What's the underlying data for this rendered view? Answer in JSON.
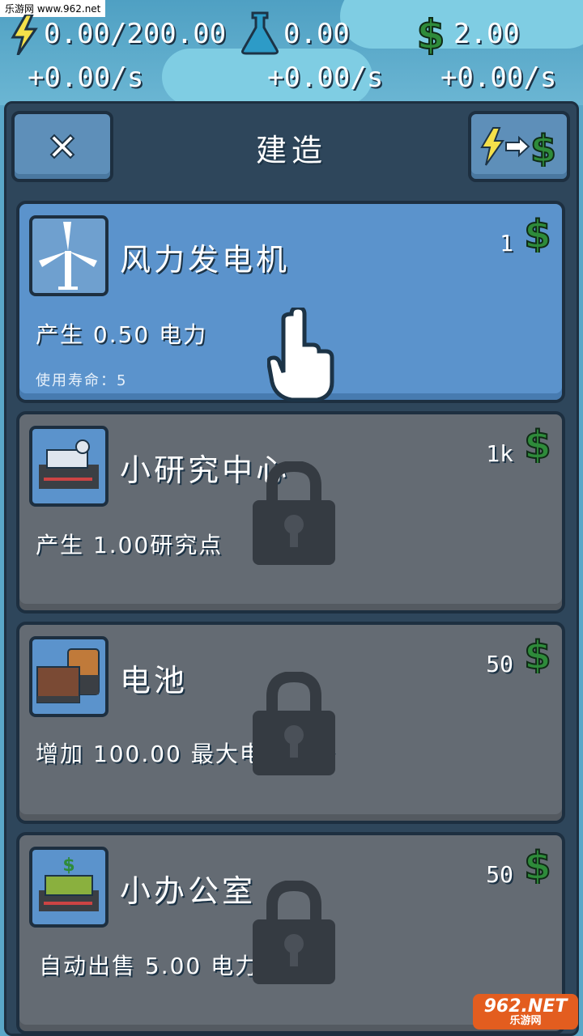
{
  "watermark_top": "乐游网 www.962.net",
  "resources": {
    "power": {
      "value": "0.00/200.00",
      "rate": "+0.00/s",
      "icon": "lightning-icon"
    },
    "research": {
      "value": "0.00",
      "rate": "+0.00/s",
      "icon": "flask-icon"
    },
    "money": {
      "value": "2.00",
      "rate": "+0.00/s",
      "icon": "dollar-icon"
    }
  },
  "header": {
    "title": "建造",
    "close_icon": "close-icon",
    "convert_icon": "power-to-money-icon"
  },
  "buildings": [
    {
      "name": "风力发电机",
      "desc": "产生 0.50 电力",
      "life": "使用寿命：5",
      "price": "1",
      "locked": false,
      "icon": "wind-turbine-icon"
    },
    {
      "name": "小研究中心",
      "desc": "产生 1.00研究点",
      "price": "1k",
      "locked": true,
      "icon": "research-center-icon"
    },
    {
      "name": "电池",
      "desc": "增加 100.00 最大电量储备",
      "price": "50",
      "locked": true,
      "icon": "battery-icon"
    },
    {
      "name": "小办公室",
      "desc": "自动出售 5.00 电力",
      "price": "50",
      "locked": true,
      "icon": "office-icon"
    }
  ],
  "watermark_bottom": {
    "logo": "962.NET",
    "text": "乐游网"
  },
  "colors": {
    "panel": "#2e465b",
    "active_card": "#5b93cc",
    "locked_card": "#646b73",
    "money_green": "#2e8b3a"
  }
}
